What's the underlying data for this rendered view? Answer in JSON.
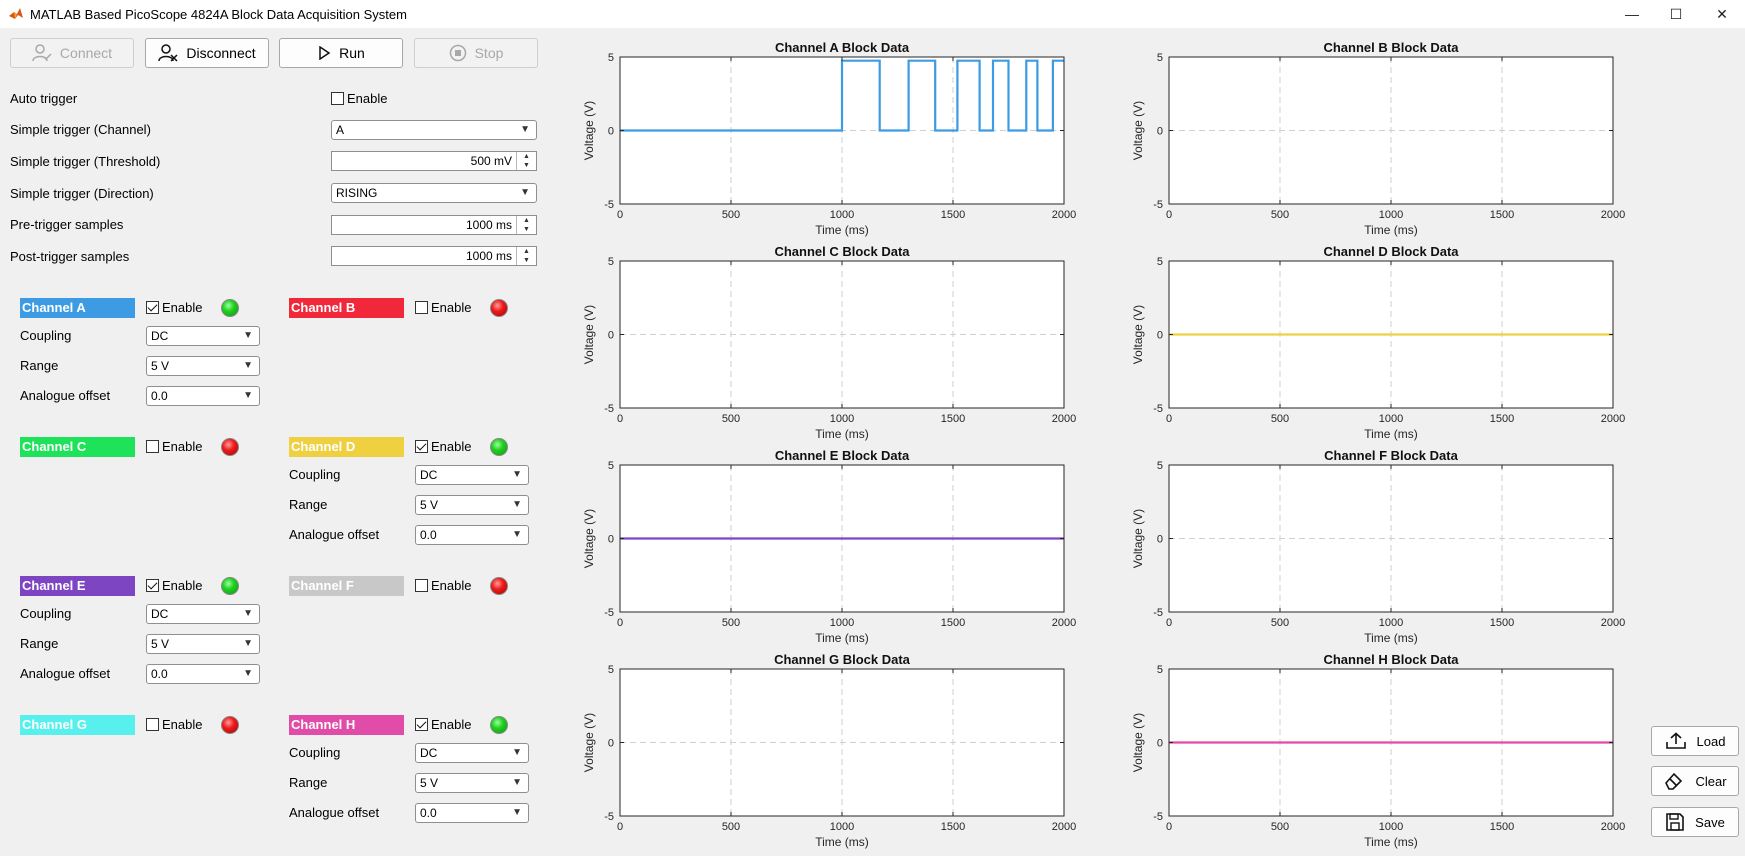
{
  "window": {
    "title": "MATLAB Based PicoScope 4824A Block Data Acquisition System",
    "minimize": "—",
    "maximize": "☐",
    "close": "✕"
  },
  "toolbar": {
    "connect_label": "Connect",
    "disconnect_label": "Disconnect",
    "run_label": "Run",
    "stop_label": "Stop"
  },
  "trigger": {
    "auto_label": "Auto trigger",
    "auto_enable_label": "Enable",
    "auto_enabled": false,
    "channel_label": "Simple trigger (Channel)",
    "channel_value": "A",
    "threshold_label": "Simple trigger (Threshold)",
    "threshold_value": "500 mV",
    "direction_label": "Simple trigger (Direction)",
    "direction_value": "RISING",
    "pre_label": "Pre-trigger samples",
    "pre_value": "1000 ms",
    "post_label": "Post-trigger samples",
    "post_value": "1000 ms"
  },
  "channel_common": {
    "enable_label": "Enable",
    "coupling_label": "Coupling",
    "range_label": "Range",
    "offset_label": "Analogue offset"
  },
  "channels": [
    {
      "name": "Channel A",
      "color": "#3c9be3",
      "enabled": true,
      "coupling": "DC",
      "range": "5 V",
      "offset": "0.0"
    },
    {
      "name": "Channel B",
      "color": "#f0283a",
      "enabled": false
    },
    {
      "name": "Channel C",
      "color": "#1ee35a",
      "enabled": false
    },
    {
      "name": "Channel D",
      "color": "#eed041",
      "enabled": true,
      "coupling": "DC",
      "range": "5 V",
      "offset": "0.0"
    },
    {
      "name": "Channel E",
      "color": "#7e45c2",
      "enabled": true,
      "coupling": "DC",
      "range": "5 V",
      "offset": "0.0"
    },
    {
      "name": "Channel F",
      "color": "#c8c8c8",
      "enabled": false
    },
    {
      "name": "Channel G",
      "color": "#58f0ec",
      "enabled": false
    },
    {
      "name": "Channel H",
      "color": "#e04ca8",
      "enabled": true,
      "coupling": "DC",
      "range": "5 V",
      "offset": "0.0"
    }
  ],
  "side_buttons": {
    "load_label": "Load",
    "clear_label": "Clear",
    "save_label": "Save"
  },
  "chart_data": [
    {
      "type": "line",
      "title": "Channel A Block Data",
      "xlabel": "Time (ms)",
      "ylabel": "Voltage (V)",
      "xlim": [
        0,
        2000
      ],
      "ylim": [
        -5,
        5
      ],
      "xticks": [
        0,
        500,
        1000,
        1500,
        2000
      ],
      "yticks": [
        -5,
        0,
        5
      ],
      "grid": true,
      "series": [
        {
          "color": "#3c9be3",
          "x": [
            0,
            1000,
            1000,
            1170,
            1170,
            1300,
            1300,
            1420,
            1420,
            1520,
            1520,
            1620,
            1620,
            1680,
            1680,
            1750,
            1750,
            1830,
            1830,
            1880,
            1880,
            1950,
            1950,
            2000
          ],
          "y": [
            0,
            0,
            4.75,
            4.75,
            0,
            0,
            4.75,
            4.75,
            0,
            0,
            4.75,
            4.75,
            0,
            0,
            4.75,
            4.75,
            0,
            0,
            4.75,
            4.75,
            0,
            0,
            4.75,
            4.75
          ]
        }
      ]
    },
    {
      "type": "line",
      "title": "Channel B Block Data",
      "xlabel": "Time (ms)",
      "ylabel": "Voltage (V)",
      "xlim": [
        0,
        2000
      ],
      "ylim": [
        -5,
        5
      ],
      "xticks": [
        0,
        500,
        1000,
        1500,
        2000
      ],
      "yticks": [
        -5,
        0,
        5
      ],
      "grid": true,
      "series": []
    },
    {
      "type": "line",
      "title": "Channel C Block Data",
      "xlabel": "Time (ms)",
      "ylabel": "Voltage (V)",
      "xlim": [
        0,
        2000
      ],
      "ylim": [
        -5,
        5
      ],
      "xticks": [
        0,
        500,
        1000,
        1500,
        2000
      ],
      "yticks": [
        -5,
        0,
        5
      ],
      "grid": true,
      "series": []
    },
    {
      "type": "line",
      "title": "Channel D Block Data",
      "xlabel": "Time (ms)",
      "ylabel": "Voltage (V)",
      "xlim": [
        0,
        2000
      ],
      "ylim": [
        -5,
        5
      ],
      "xticks": [
        0,
        500,
        1000,
        1500,
        2000
      ],
      "yticks": [
        -5,
        0,
        5
      ],
      "grid": true,
      "series": [
        {
          "color": "#eed041",
          "x": [
            0,
            2000
          ],
          "y": [
            0,
            0
          ]
        }
      ]
    },
    {
      "type": "line",
      "title": "Channel E Block Data",
      "xlabel": "Time (ms)",
      "ylabel": "Voltage (V)",
      "xlim": [
        0,
        2000
      ],
      "ylim": [
        -5,
        5
      ],
      "xticks": [
        0,
        500,
        1000,
        1500,
        2000
      ],
      "yticks": [
        -5,
        0,
        5
      ],
      "grid": true,
      "series": [
        {
          "color": "#7e45c2",
          "x": [
            0,
            2000
          ],
          "y": [
            0,
            0
          ]
        }
      ]
    },
    {
      "type": "line",
      "title": "Channel F Block Data",
      "xlabel": "Time (ms)",
      "ylabel": "Voltage (V)",
      "xlim": [
        0,
        2000
      ],
      "ylim": [
        -5,
        5
      ],
      "xticks": [
        0,
        500,
        1000,
        1500,
        2000
      ],
      "yticks": [
        -5,
        0,
        5
      ],
      "grid": true,
      "series": []
    },
    {
      "type": "line",
      "title": "Channel G Block Data",
      "xlabel": "Time (ms)",
      "ylabel": "Voltage (V)",
      "xlim": [
        0,
        2000
      ],
      "ylim": [
        -5,
        5
      ],
      "xticks": [
        0,
        500,
        1000,
        1500,
        2000
      ],
      "yticks": [
        -5,
        0,
        5
      ],
      "grid": true,
      "series": []
    },
    {
      "type": "line",
      "title": "Channel H Block Data",
      "xlabel": "Time (ms)",
      "ylabel": "Voltage (V)",
      "xlim": [
        0,
        2000
      ],
      "ylim": [
        -5,
        5
      ],
      "xticks": [
        0,
        500,
        1000,
        1500,
        2000
      ],
      "yticks": [
        -5,
        0,
        5
      ],
      "grid": true,
      "series": [
        {
          "color": "#e04ca8",
          "x": [
            0,
            2000
          ],
          "y": [
            0,
            0
          ]
        }
      ]
    }
  ]
}
